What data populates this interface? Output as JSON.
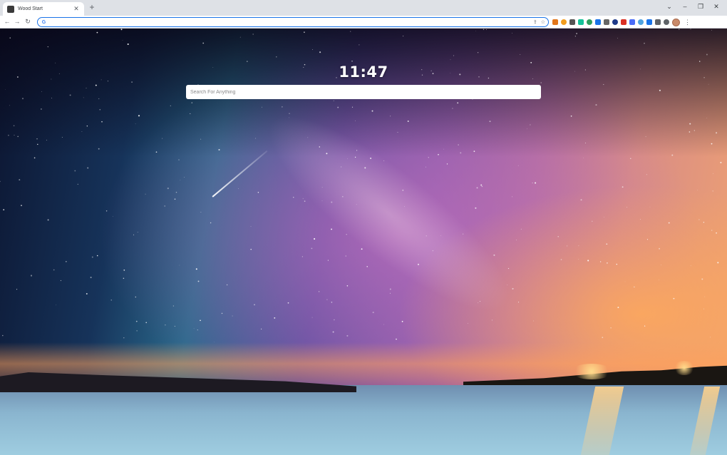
{
  "tab": {
    "title": "Wood Start",
    "close_icon": "close-icon",
    "favicon": "wood-start-favicon"
  },
  "new_tab_label": "+",
  "window_controls": {
    "collapse": "⌄",
    "minimize": "–",
    "restore": "❐",
    "close": "✕"
  },
  "toolbar": {
    "back": "←",
    "forward": "→",
    "reload": "↻",
    "omnibox_value": "",
    "share_icon": "⇪",
    "star_icon": "☆"
  },
  "extensions": [
    {
      "name": "metamask-icon",
      "color": "#e2761b"
    },
    {
      "name": "orange-circle-icon",
      "color": "#f29d1f"
    },
    {
      "name": "ext-m-icon",
      "color": "#555555"
    },
    {
      "name": "grammarly-icon",
      "color": "#15c39a"
    },
    {
      "name": "green-ext-icon",
      "color": "#2e9e5e"
    },
    {
      "name": "blue-circle-icon",
      "color": "#1a73e8"
    },
    {
      "name": "dollar-ext-icon",
      "color": "#666666"
    },
    {
      "name": "dark-blue-ext-icon",
      "color": "#1e3a8a"
    },
    {
      "name": "pen-ext-icon",
      "color": "#d93025"
    },
    {
      "name": "blue-square-icon",
      "color": "#4a6cf7"
    },
    {
      "name": "light-blue-ext-icon",
      "color": "#4fa3e0"
    },
    {
      "name": "shield-ext-icon",
      "color": "#1a73e8"
    },
    {
      "name": "puzzle-icon",
      "color": "#5f6368"
    },
    {
      "name": "sidepanel-icon",
      "color": "#5f6368"
    }
  ],
  "menu_dots": "⋮",
  "clock": {
    "time": "11:47"
  },
  "search": {
    "placeholder": "Search For Anything",
    "value": ""
  }
}
